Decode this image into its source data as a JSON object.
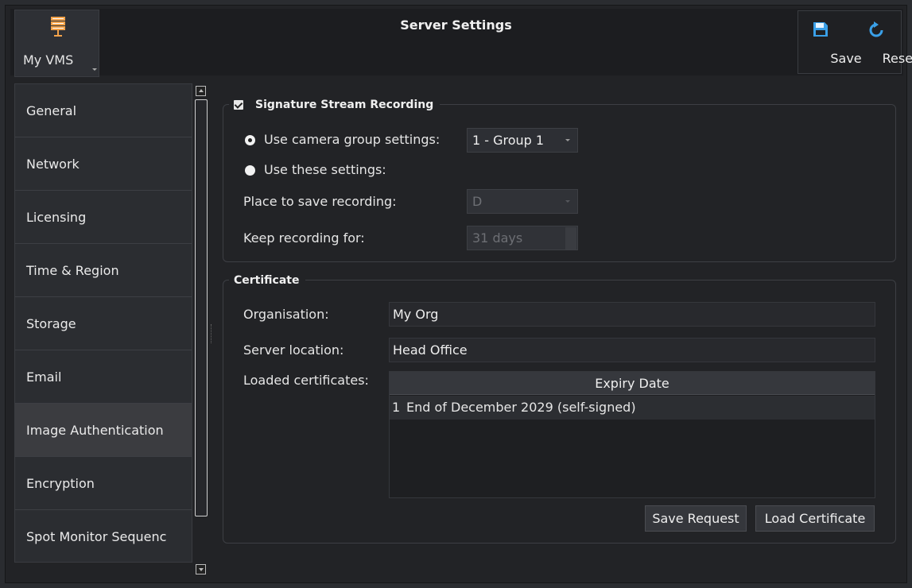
{
  "app": {
    "name": "My VMS",
    "icon": "server-stack-icon"
  },
  "header": {
    "title": "Server Settings"
  },
  "toolbar": {
    "save_label": "Save",
    "reset_label": "Reset",
    "save_icon": "floppy-disk-icon",
    "reset_icon": "refresh-icon"
  },
  "sidebar": {
    "items": [
      {
        "label": "General"
      },
      {
        "label": "Network"
      },
      {
        "label": "Licensing"
      },
      {
        "label": "Time & Region"
      },
      {
        "label": "Storage"
      },
      {
        "label": "Email"
      },
      {
        "label": "Image Authentication",
        "active": true
      },
      {
        "label": "Encryption"
      },
      {
        "label": "Spot Monitor Sequenc"
      }
    ]
  },
  "signature": {
    "title": "Signature Stream Recording",
    "checked": true,
    "use_group_label": "Use camera group settings:",
    "group_value": "1 - Group 1",
    "use_these_label": "Use these settings:",
    "place_label": "Place to save recording:",
    "place_value": "D",
    "keep_label": "Keep recording for:",
    "keep_value": "31 days"
  },
  "certificate": {
    "title": "Certificate",
    "org_label": "Organisation:",
    "org_value": "My Org",
    "location_label": "Server location:",
    "location_value": "Head Office",
    "loaded_label": "Loaded certificates:",
    "table_header": "Expiry Date",
    "rows": [
      {
        "index": "1",
        "expiry": "End of December 2029 (self-signed)"
      }
    ],
    "save_request_label": "Save Request",
    "load_certificate_label": "Load Certificate"
  },
  "colors": {
    "background": "#222326",
    "panel": "#2b2d31",
    "active_item": "#3b3c40",
    "accent_icon": "#3aa0e8"
  }
}
